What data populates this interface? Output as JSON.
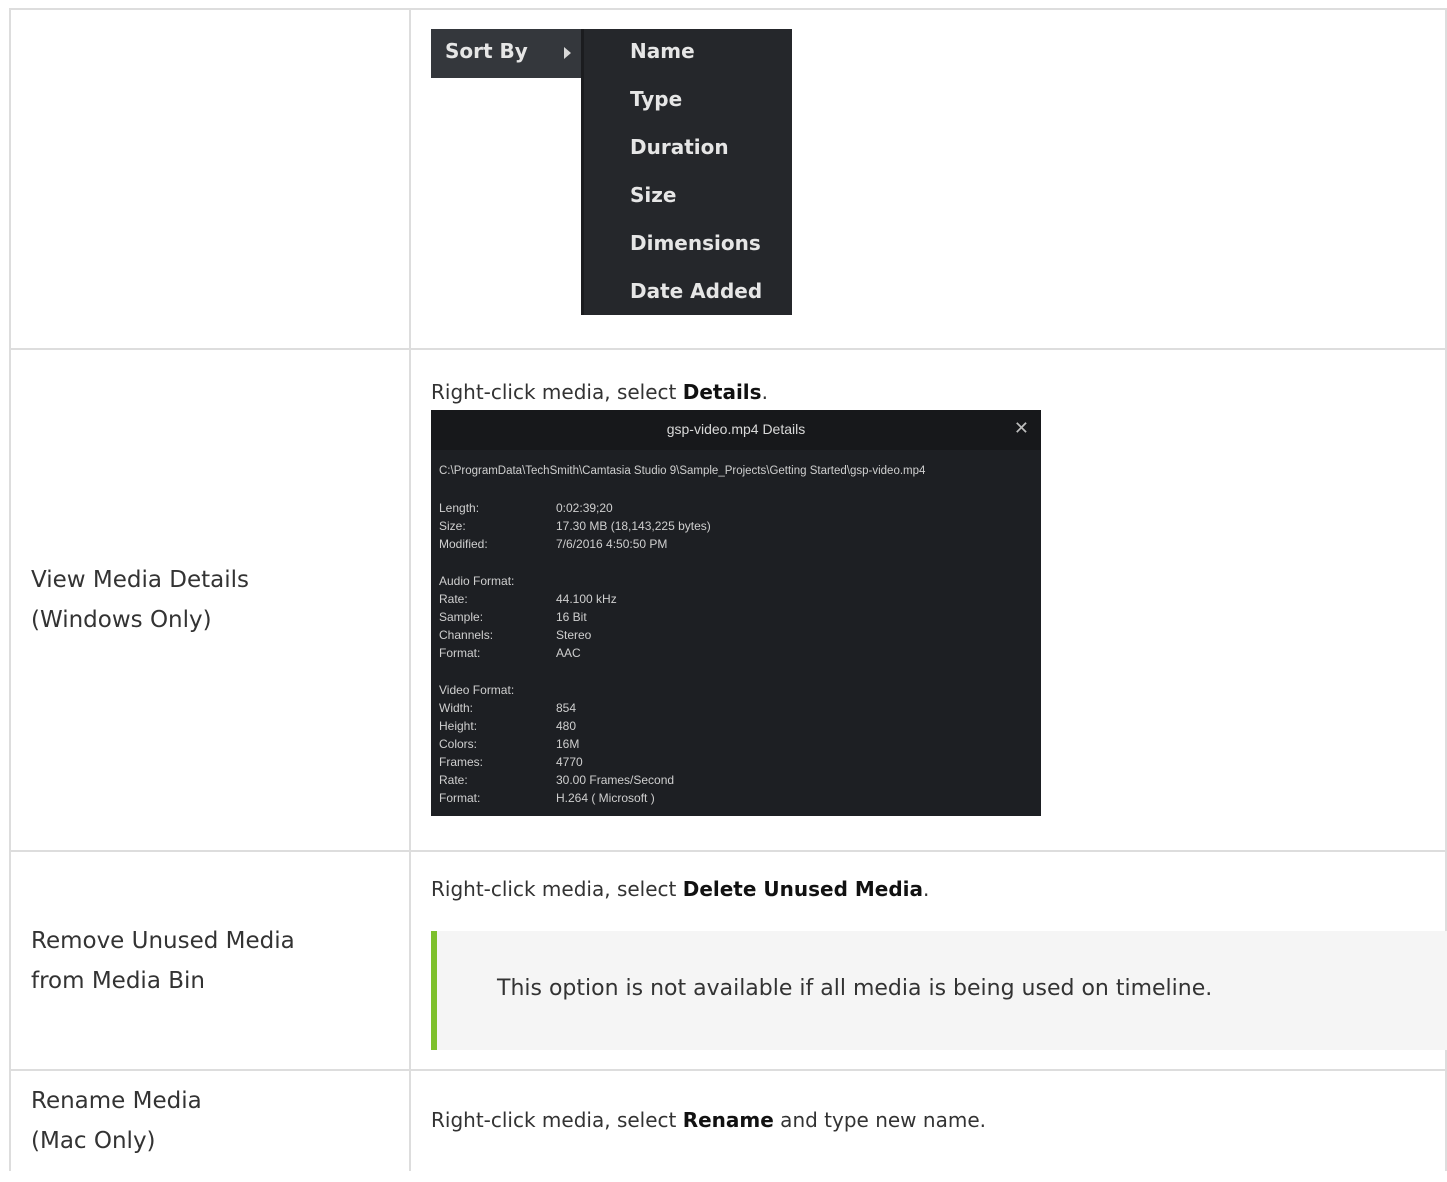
{
  "sort_menu": {
    "label": "Sort By",
    "items": [
      "Name",
      "Type",
      "Duration",
      "Size",
      "Dimensions",
      "Date Added"
    ]
  },
  "details_row": {
    "left_line1": "View Media Details",
    "left_line2": "(Windows Only)",
    "instruction_prefix": "Right-click media, select ",
    "instruction_bold": "Details",
    "instruction_suffix": ".",
    "dialog": {
      "title": "gsp-video.mp4 Details",
      "close": "✕",
      "path": "C:\\ProgramData\\TechSmith\\Camtasia Studio 9\\Sample_Projects\\Getting Started\\gsp-video.mp4",
      "general": [
        {
          "k": "Length:",
          "v": "0:02:39;20"
        },
        {
          "k": "Size:",
          "v": "17.30 MB (18,143,225 bytes)"
        },
        {
          "k": "Modified:",
          "v": "7/6/2016 4:50:50 PM"
        }
      ],
      "audio_header": "Audio Format:",
      "audio": [
        {
          "k": "Rate:",
          "v": "44.100 kHz"
        },
        {
          "k": "Sample:",
          "v": "16 Bit"
        },
        {
          "k": "Channels:",
          "v": "Stereo"
        },
        {
          "k": "Format:",
          "v": "AAC"
        }
      ],
      "video_header": "Video Format:",
      "video": [
        {
          "k": "Width:",
          "v": "854"
        },
        {
          "k": "Height:",
          "v": "480"
        },
        {
          "k": "Colors:",
          "v": "16M"
        },
        {
          "k": "Frames:",
          "v": "4770"
        },
        {
          "k": "Rate:",
          "v": "30.00 Frames/Second"
        },
        {
          "k": "Format:",
          "v": "H.264 ( Microsoft )"
        }
      ]
    }
  },
  "unused_row": {
    "left_line1": "Remove Unused Media",
    "left_line2": "from Media Bin",
    "instruction_prefix": "Right-click media, select ",
    "instruction_bold": "Delete Unused Media",
    "instruction_suffix": ".",
    "note": "This option is not available if all media is being used on timeline."
  },
  "rename_row": {
    "left_line1": "Rename Media",
    "left_line2": "(Mac Only)",
    "instruction_prefix": "Right-click media, select ",
    "instruction_bold": "Rename",
    "instruction_suffix": " and type new name."
  }
}
